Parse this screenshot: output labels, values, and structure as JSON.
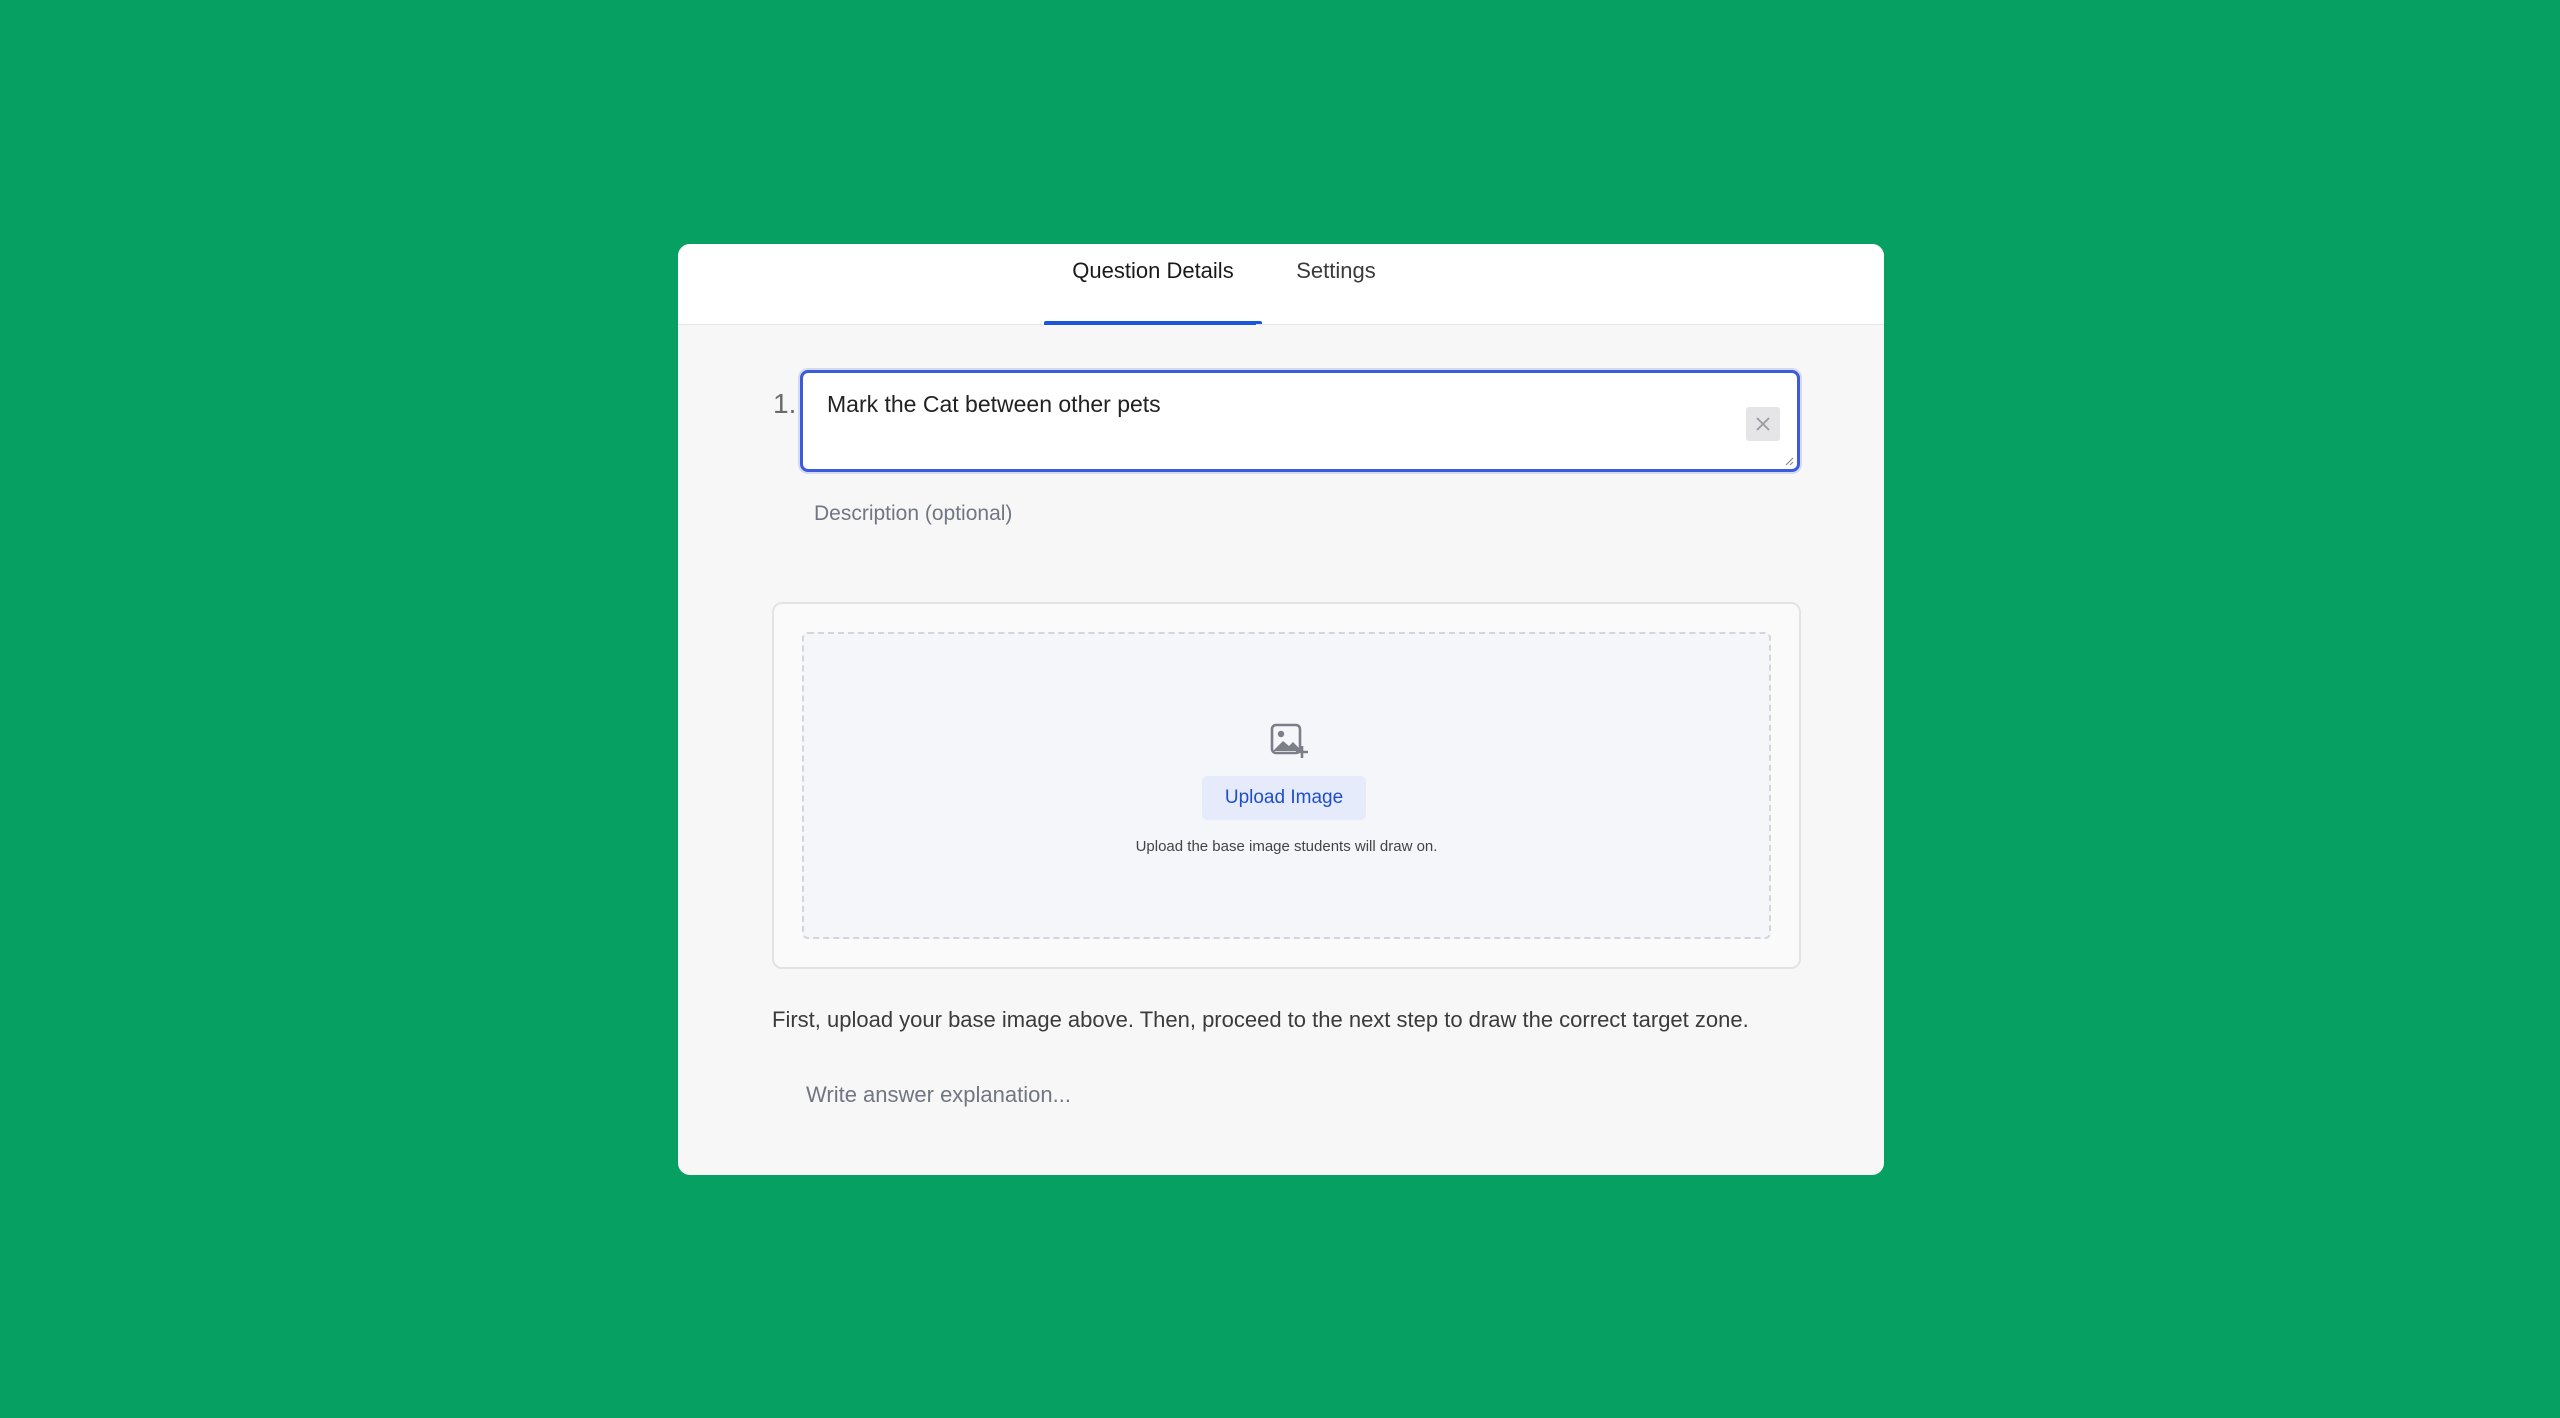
{
  "tabs": {
    "details_label": "Question Details",
    "settings_label": "Settings"
  },
  "question": {
    "number": "1.",
    "text": "Mark the Cat between other pets",
    "description_placeholder": "Description (optional)"
  },
  "upload": {
    "button_label": "Upload Image",
    "hint": "Upload the base image students will draw on."
  },
  "instruction": "First, upload your base image above. Then, proceed to the next step to draw the correct target zone.",
  "explanation_placeholder": "Write answer explanation...",
  "colors": {
    "background": "#05a062",
    "accent": "#1a56db",
    "focus_border": "#3b5bdb",
    "upload_button_bg": "#e6ebfb"
  },
  "icons": {
    "clear": "close-icon",
    "upload": "image-add-icon"
  }
}
